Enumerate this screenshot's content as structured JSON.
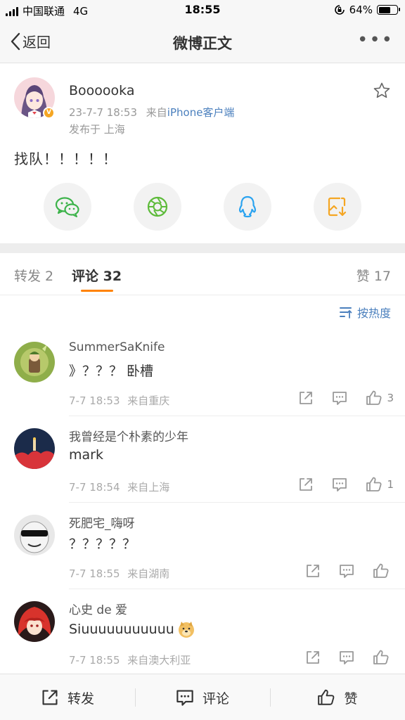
{
  "status_bar": {
    "carrier": "中国联通",
    "network": "4G",
    "time": "18:55",
    "battery": "64%",
    "battery_level": 0.64
  },
  "nav": {
    "back_label": "返回",
    "title": "微博正文"
  },
  "post": {
    "author": "Boooooka",
    "time": "23-7-7 18:53",
    "source_prefix": "来自",
    "source": "iPhone客户端",
    "location": "发布于 上海",
    "text": "找队！！！！！",
    "share_targets": [
      "wechat-icon",
      "moments-icon",
      "qq-icon",
      "save-image-icon"
    ]
  },
  "tabs": {
    "repost": "转发 2",
    "comments": "评论 32",
    "likes": "赞 17",
    "sort_label": "按热度"
  },
  "comments": [
    {
      "name": "SummerSaKnife",
      "text": "》？？？ 卧槽",
      "time": "7-7 18:53",
      "location": "来自重庆",
      "likes": "3"
    },
    {
      "name": "我曾经是个朴素的少年",
      "text": "mark",
      "time": "7-7 18:54",
      "location": "来自上海",
      "likes": "1"
    },
    {
      "name": "死肥宅_嗨呀",
      "text": "？？？？？",
      "time": "7-7 18:55",
      "location": "来自湖南",
      "likes": ""
    },
    {
      "name": "心史 de 爱",
      "text": "Siuuuuuuuuuuu",
      "time": "7-7 18:55",
      "location": "来自澳大利亚",
      "likes": ""
    }
  ],
  "bottom_bar": {
    "repost": "转发",
    "comment": "评论",
    "like": "赞"
  },
  "colors": {
    "accent": "#ff8200",
    "link": "#4a7fbd",
    "wechat": "#3cb34a",
    "qq": "#2aa3f0",
    "save": "#f5a623"
  }
}
